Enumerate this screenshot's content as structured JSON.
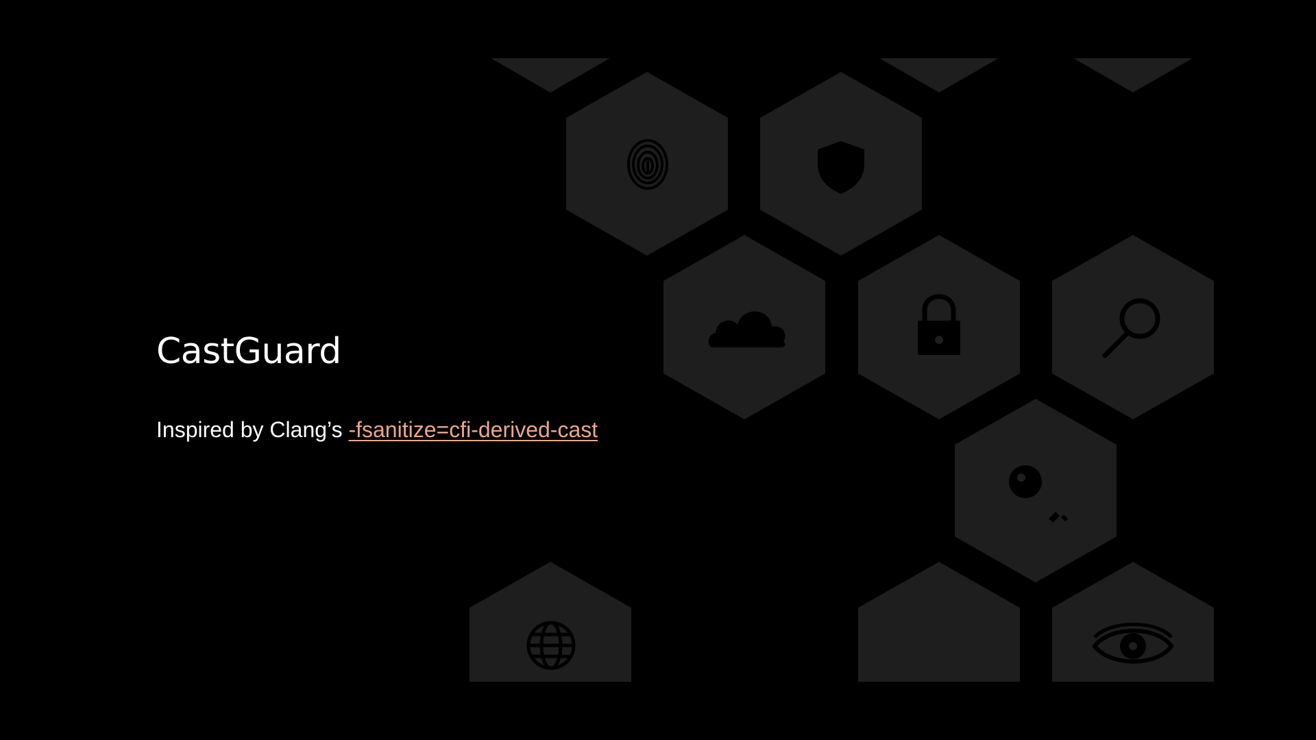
{
  "slide": {
    "title": "CastGuard",
    "subtitle_prefix": "Inspired by Clang’s ",
    "subtitle_link": "-fsanitize=cfi-derived-cast"
  },
  "colors": {
    "background": "#000000",
    "hexagon_fill": "#1e1e1e",
    "icon_fill": "#000000",
    "text": "#ffffff",
    "link": "#e9a98a"
  },
  "decorative_icons": [
    "fingerprint-icon",
    "shield-icon",
    "cloud-icon",
    "padlock-icon",
    "magnifier-icon",
    "key-icon",
    "globe-icon",
    "eye-icon"
  ]
}
